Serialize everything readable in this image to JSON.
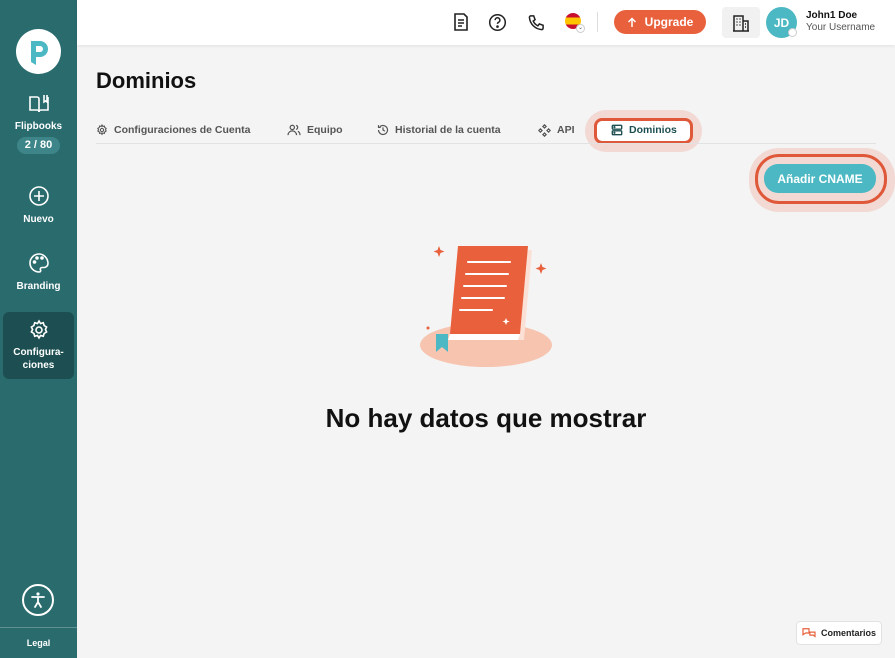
{
  "sidebar": {
    "items": [
      {
        "label": "Flipbooks",
        "badge": "2 / 80",
        "icon": "book-open-icon"
      },
      {
        "label": "Nuevo",
        "icon": "plus-circle-icon"
      },
      {
        "label": "Branding",
        "icon": "palette-icon"
      },
      {
        "label": "Configura-ciones",
        "icon": "gear-icon",
        "active": true
      }
    ],
    "legal": "Legal"
  },
  "topbar": {
    "upgrade_label": "Upgrade",
    "language": "es",
    "user": {
      "initials": "JD",
      "name": "John1 Doe",
      "username": "Your Username"
    }
  },
  "page": {
    "title": "Dominios",
    "tabs": [
      {
        "label": "Configuraciones de Cuenta",
        "icon": "gear-icon"
      },
      {
        "label": "Equipo",
        "icon": "users-icon"
      },
      {
        "label": "Historial de la cuenta",
        "icon": "history-icon"
      },
      {
        "label": "API",
        "icon": "api-icon"
      },
      {
        "label": "Dominios",
        "icon": "server-icon",
        "active": true
      }
    ],
    "add_cname_label": "Añadir CNAME",
    "empty_message": "No hay datos que mostrar"
  },
  "feedback_label": "Comentarios",
  "colors": {
    "sidebar": "#2a6b6e",
    "accent_orange": "#e8603c",
    "accent_teal": "#4cb8c4"
  }
}
